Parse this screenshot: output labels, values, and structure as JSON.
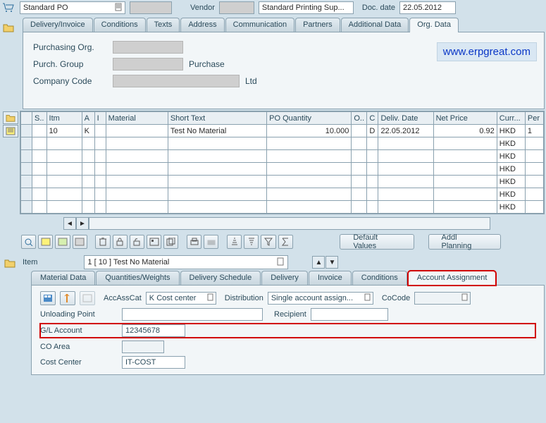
{
  "header": {
    "po_type": "Standard PO",
    "vendor_label": "Vendor",
    "vendor_name": "Standard Printing Sup...",
    "doc_date_label": "Doc. date",
    "doc_date": "22.05.2012"
  },
  "tabs": {
    "t0": "Delivery/Invoice",
    "t1": "Conditions",
    "t2": "Texts",
    "t3": "Address",
    "t4": "Communication",
    "t5": "Partners",
    "t6": "Additional Data",
    "t7": "Org. Data"
  },
  "org": {
    "purch_org_label": "Purchasing Org.",
    "purch_group_label": "Purch. Group",
    "purch_group_text": "Purchase",
    "company_code_label": "Company Code",
    "company_code_text": "Ltd"
  },
  "brand": "www.erpgreat.com",
  "grid": {
    "cols": {
      "s": "S..",
      "itm": "Itm",
      "a": "A",
      "i": "I",
      "mat": "Material",
      "stext": "Short Text",
      "poq": "PO Quantity",
      "o": "O..",
      "c": "C",
      "ddate": "Deliv. Date",
      "nprice": "Net Price",
      "curr": "Curr...",
      "per": "Per"
    },
    "rows": [
      {
        "itm": "10",
        "a": "K",
        "i": "",
        "mat": "",
        "stext": "Test No Material",
        "poq": "10.000",
        "o": "",
        "c": "D",
        "ddate": "22.05.2012",
        "nprice": "0.92",
        "curr": "HKD",
        "per": "1"
      },
      {
        "itm": "",
        "a": "",
        "i": "",
        "mat": "",
        "stext": "",
        "poq": "",
        "o": "",
        "c": "",
        "ddate": "",
        "nprice": "",
        "curr": "HKD",
        "per": ""
      },
      {
        "itm": "",
        "a": "",
        "i": "",
        "mat": "",
        "stext": "",
        "poq": "",
        "o": "",
        "c": "",
        "ddate": "",
        "nprice": "",
        "curr": "HKD",
        "per": ""
      },
      {
        "itm": "",
        "a": "",
        "i": "",
        "mat": "",
        "stext": "",
        "poq": "",
        "o": "",
        "c": "",
        "ddate": "",
        "nprice": "",
        "curr": "HKD",
        "per": ""
      },
      {
        "itm": "",
        "a": "",
        "i": "",
        "mat": "",
        "stext": "",
        "poq": "",
        "o": "",
        "c": "",
        "ddate": "",
        "nprice": "",
        "curr": "HKD",
        "per": ""
      },
      {
        "itm": "",
        "a": "",
        "i": "",
        "mat": "",
        "stext": "",
        "poq": "",
        "o": "",
        "c": "",
        "ddate": "",
        "nprice": "",
        "curr": "HKD",
        "per": ""
      },
      {
        "itm": "",
        "a": "",
        "i": "",
        "mat": "",
        "stext": "",
        "poq": "",
        "o": "",
        "c": "",
        "ddate": "",
        "nprice": "",
        "curr": "HKD",
        "per": ""
      }
    ]
  },
  "buttons": {
    "default_values": "Default Values",
    "addl_planning": "Addl Planning"
  },
  "item_select": {
    "label": "Item",
    "value": "1 [ 10 ] Test No Material"
  },
  "dtabs": {
    "t0": "Material Data",
    "t1": "Quantities/Weights",
    "t2": "Delivery Schedule",
    "t3": "Delivery",
    "t4": "Invoice",
    "t5": "Conditions",
    "t6": "Account Assignment"
  },
  "aa": {
    "accasscat_label": "AccAssCat",
    "accasscat_value": "K Cost center",
    "distribution_label": "Distribution",
    "distribution_value": "Single account assign...",
    "cocode_label": "CoCode",
    "unloading_label": "Unloading Point",
    "recipient_label": "Recipient",
    "glaccount_label": "G/L Account",
    "glaccount_value": "12345678",
    "coarea_label": "CO Area",
    "costcenter_label": "Cost Center",
    "costcenter_value": "IT-COST"
  }
}
